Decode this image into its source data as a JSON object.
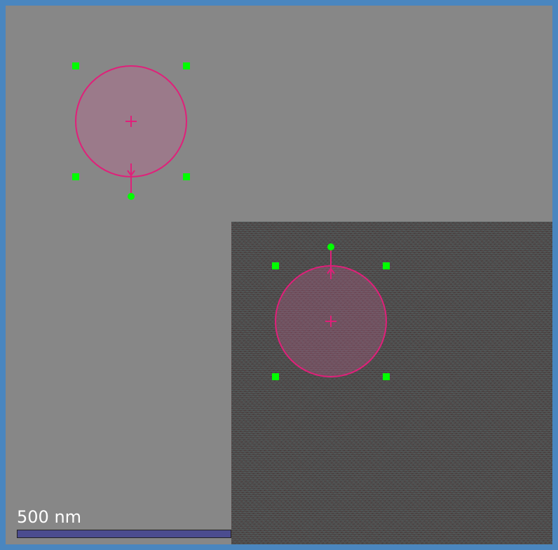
{
  "colors": {
    "window_border": "#4a86bf",
    "background": "#878787",
    "roi_stroke": "#e0207a",
    "roi_fill": "#c06090",
    "handle": "#00ff00",
    "scale_bar": "#4b4c8f",
    "scale_text": "#ffffff"
  },
  "icons": {
    "center": "crosshair-icon",
    "rotate": "rotate-handle-icon",
    "direction": "arrow-icon"
  },
  "scale_bar": {
    "label": "500 nm"
  }
}
